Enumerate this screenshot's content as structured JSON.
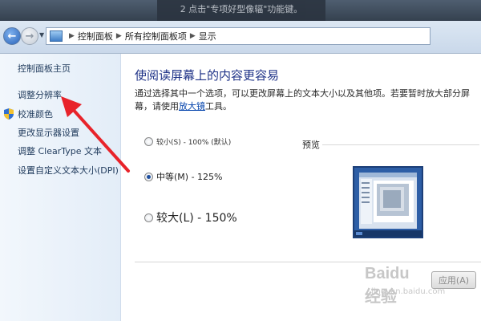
{
  "top_banner": {
    "text": "2 点击\"专项好型像辐\"功能键。"
  },
  "address_bar": {
    "crumbs": [
      "控制面板",
      "所有控制面板项",
      "显示"
    ]
  },
  "left_nav": {
    "home": "控制面板主页",
    "items": [
      "调整分辨率",
      "校准颜色",
      "更改显示器设置",
      "调整 ClearType 文本",
      "设置自定义文本大小(DPI)"
    ]
  },
  "main": {
    "title": "使阅读屏幕上的内容更容易",
    "desc_text": "通过选择其中一个选项，可以更改屏幕上的文本大小以及其他项。若要暂时放大部分屏幕，请使用",
    "desc_link": "放大镜",
    "desc_tail": "工具。",
    "options": [
      {
        "label": "较小(S) - 100% (默认)",
        "checked": false
      },
      {
        "label": "中等(M) - 125%",
        "checked": true
      },
      {
        "label": "较大(L) - 150%",
        "checked": false
      }
    ],
    "preview_label": "预览",
    "apply_button": "应用(A)"
  },
  "watermark": {
    "brand": "Baidu 经验",
    "url": "jingyan.baidu.com"
  },
  "colors": {
    "annotation_arrow": "#e8232a",
    "title": "#1e3287",
    "link": "#0645ad"
  }
}
